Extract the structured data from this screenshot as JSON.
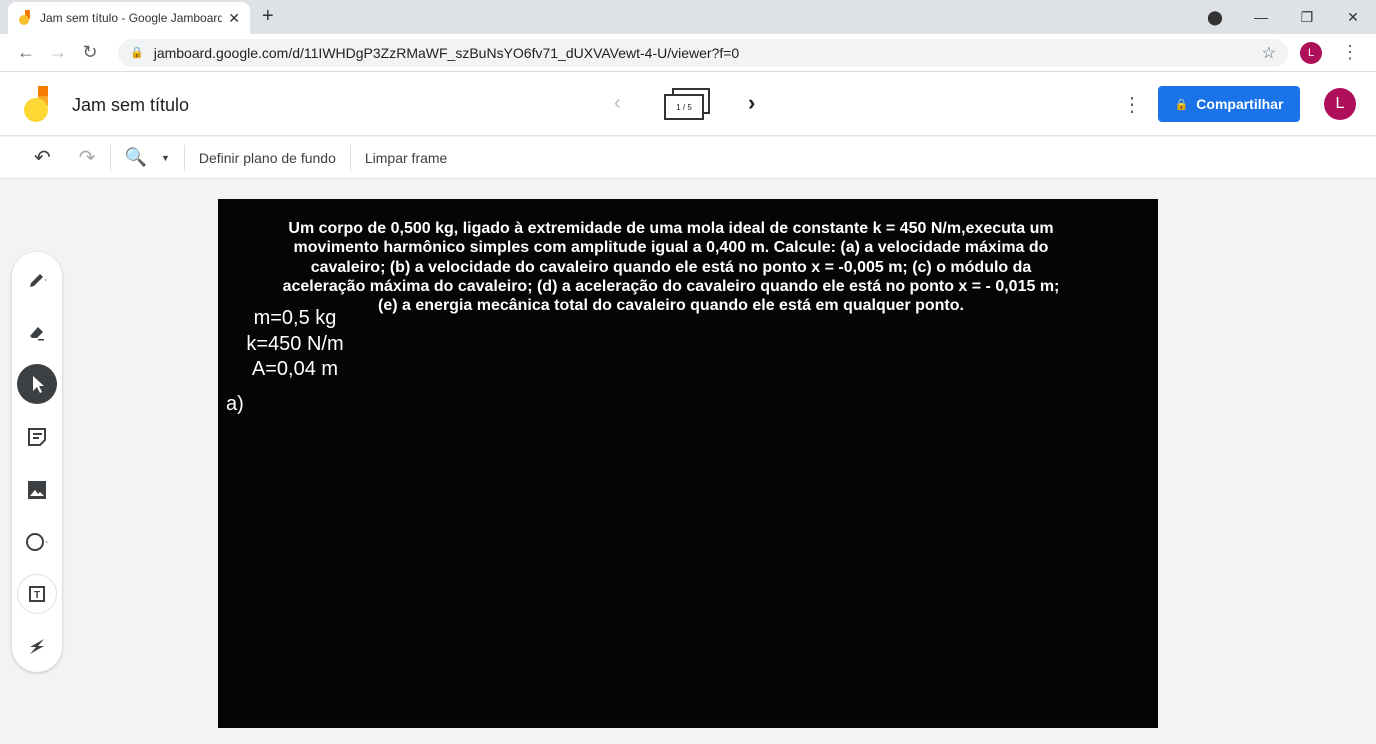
{
  "browser": {
    "tab_title": "Jam sem título - Google Jamboard",
    "url": "jamboard.google.com/d/11IWHDgP3ZzRMaWF_szBuNsYO6fv71_dUXVAVewt-4-U/viewer?f=0",
    "profile_initial": "L"
  },
  "app": {
    "title": "Jam sem título",
    "frame_indicator": "1 / 5",
    "share_label": "Compartilhar",
    "avatar_initial": "L",
    "accent": "#1a73e8"
  },
  "toolbar": {
    "background_label": "Definir plano de fundo",
    "clear_label": "Limpar frame"
  },
  "canvas": {
    "question": "Um corpo de 0,500 kg, ligado à extremidade de uma mola ideal de constante k = 450 N/m,executa um movimento harmônico simples com amplitude igual a 0,400 m. Calcule: (a) a velocidade máxima do cavaleiro; (b) a velocidade do cavaleiro quando ele está no ponto x = -0,005 m; (c) o módulo da aceleração máxima do cavaleiro; (d) a aceleração do cavaleiro quando ele está no ponto x = - 0,015 m; (e) a energia mecânica total do cavaleiro quando ele está em qualquer ponto.",
    "given": [
      "m=0,5 kg",
      "k=450 N/m",
      "A=0,04 m"
    ],
    "part_a": "a)"
  }
}
